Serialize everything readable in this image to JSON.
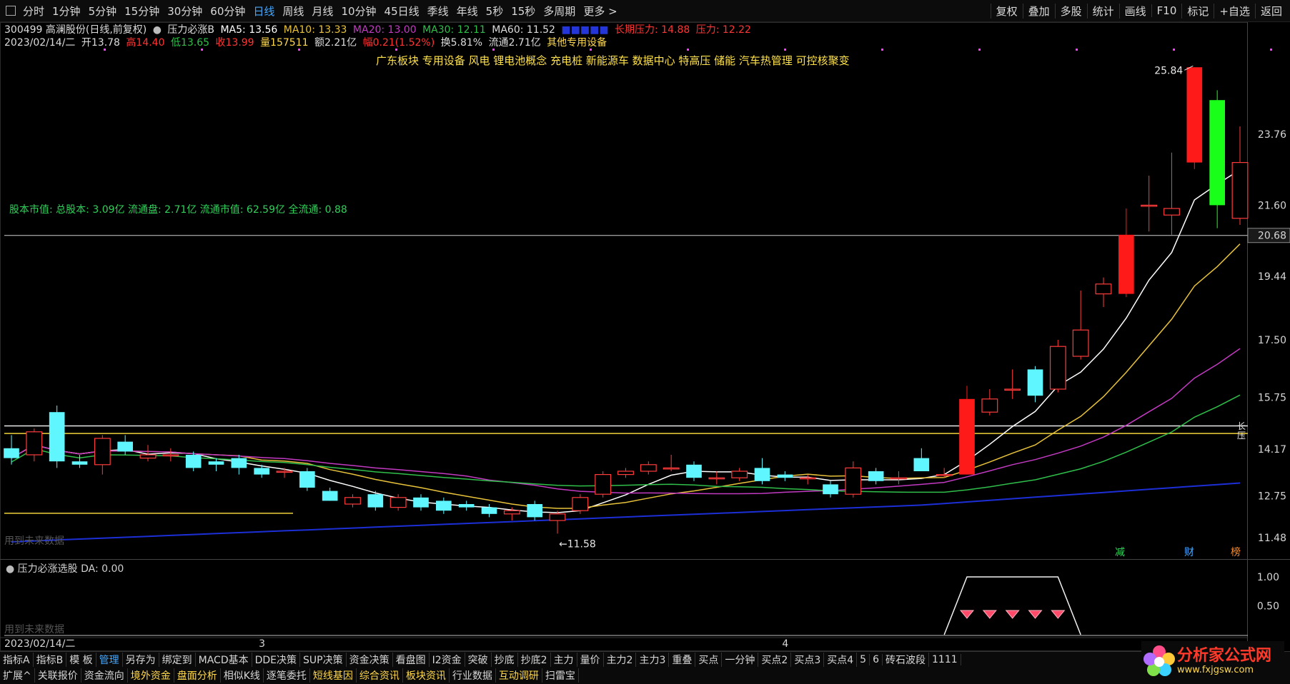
{
  "toolbar": {
    "periods": [
      "分时",
      "1分钟",
      "5分钟",
      "15分钟",
      "30分钟",
      "60分钟",
      "日线",
      "周线",
      "月线",
      "10分钟",
      "45日线",
      "季线",
      "年线",
      "5秒",
      "15秒",
      "多周期",
      "更多 >"
    ],
    "active_period": "日线",
    "right_buttons": [
      "复权",
      "叠加",
      "多股",
      "统计",
      "画线",
      "F10",
      "标记",
      "+自选",
      "返回"
    ]
  },
  "info": {
    "stock": "300499 高澜股份(日线,前复权)",
    "indicator": "压力必涨B",
    "ma5": "MA5: 13.56",
    "ma10": "MA10: 13.33",
    "ma20": "MA20: 13.00",
    "ma30": "MA30: 12.11",
    "ma60": "MA60: 11.52",
    "long_pressure": "长期压力: 14.88",
    "pressure": "压力: 12.22",
    "date": "2023/02/14/二",
    "open": "开13.78",
    "high": "高14.40",
    "low": "低13.65",
    "close": "收13.99",
    "volume": "量157511",
    "amount": "额2.21亿",
    "change": "幅0.21(1.52%)",
    "turnover": "换5.81%",
    "float": "流通2.71亿",
    "industry": "其他专用设备"
  },
  "tagline": "广东板块 专用设备 风电 锂电池概念 充电桩 新能源车 数据中心 特高压 储能 汽车热管理 可控核聚变",
  "share_text": "股本市值: 总股本: 3.09亿 流通盘: 2.71亿 流通市值: 62.59亿 全流通: 0.88",
  "watermark": "用到未来数据",
  "chart_data": {
    "type": "candlestick",
    "y_axis_labels": [
      "23.76",
      "21.60",
      "20.68",
      "19.44",
      "17.50",
      "15.75",
      "14.17",
      "12.75",
      "11.48"
    ],
    "ylim": [
      11.0,
      26.5
    ],
    "highlight_price": "20.68",
    "max_label": "25.84",
    "min_label": "11.58",
    "candles": [
      {
        "o": 14.2,
        "c": 13.9,
        "h": 14.6,
        "l": 13.7
      },
      {
        "o": 14.0,
        "c": 14.7,
        "h": 14.8,
        "l": 13.8
      },
      {
        "o": 15.3,
        "c": 13.8,
        "h": 15.5,
        "l": 13.6
      },
      {
        "o": 13.8,
        "c": 13.7,
        "h": 14.0,
        "l": 13.6
      },
      {
        "o": 13.7,
        "c": 14.5,
        "h": 14.6,
        "l": 13.4
      },
      {
        "o": 14.4,
        "c": 14.1,
        "h": 14.6,
        "l": 14.0
      },
      {
        "o": 13.9,
        "c": 14.0,
        "h": 14.3,
        "l": 13.8
      },
      {
        "o": 14.0,
        "c": 14.0,
        "h": 14.2,
        "l": 13.8
      },
      {
        "o": 14.0,
        "c": 13.6,
        "h": 14.1,
        "l": 13.5
      },
      {
        "o": 13.8,
        "c": 13.7,
        "h": 13.9,
        "l": 13.5
      },
      {
        "o": 13.9,
        "c": 13.6,
        "h": 14.0,
        "l": 13.4
      },
      {
        "o": 13.6,
        "c": 13.4,
        "h": 13.7,
        "l": 13.3
      },
      {
        "o": 13.5,
        "c": 13.5,
        "h": 13.6,
        "l": 13.3
      },
      {
        "o": 13.5,
        "c": 13.0,
        "h": 13.6,
        "l": 12.9
      },
      {
        "o": 12.9,
        "c": 12.6,
        "h": 13.0,
        "l": 12.6
      },
      {
        "o": 12.5,
        "c": 12.7,
        "h": 12.8,
        "l": 12.4
      },
      {
        "o": 12.8,
        "c": 12.4,
        "h": 12.9,
        "l": 12.3
      },
      {
        "o": 12.4,
        "c": 12.7,
        "h": 12.8,
        "l": 12.3
      },
      {
        "o": 12.7,
        "c": 12.4,
        "h": 12.8,
        "l": 12.3
      },
      {
        "o": 12.6,
        "c": 12.3,
        "h": 12.7,
        "l": 12.2
      },
      {
        "o": 12.5,
        "c": 12.4,
        "h": 12.6,
        "l": 12.3
      },
      {
        "o": 12.4,
        "c": 12.2,
        "h": 12.5,
        "l": 12.1
      },
      {
        "o": 12.2,
        "c": 12.3,
        "h": 12.4,
        "l": 12.0
      },
      {
        "o": 12.5,
        "c": 12.1,
        "h": 12.6,
        "l": 12.0
      },
      {
        "o": 12.0,
        "c": 12.2,
        "h": 12.3,
        "l": 11.6
      },
      {
        "o": 12.3,
        "c": 12.7,
        "h": 12.8,
        "l": 12.2
      },
      {
        "o": 12.8,
        "c": 13.4,
        "h": 13.5,
        "l": 12.7
      },
      {
        "o": 13.4,
        "c": 13.5,
        "h": 13.6,
        "l": 13.3
      },
      {
        "o": 13.5,
        "c": 13.7,
        "h": 13.8,
        "l": 13.4
      },
      {
        "o": 13.6,
        "c": 13.6,
        "h": 14.0,
        "l": 13.5
      },
      {
        "o": 13.7,
        "c": 13.3,
        "h": 13.8,
        "l": 13.2
      },
      {
        "o": 13.3,
        "c": 13.3,
        "h": 13.5,
        "l": 13.1
      },
      {
        "o": 13.3,
        "c": 13.5,
        "h": 13.6,
        "l": 13.2
      },
      {
        "o": 13.6,
        "c": 13.2,
        "h": 13.9,
        "l": 13.1
      },
      {
        "o": 13.4,
        "c": 13.3,
        "h": 13.5,
        "l": 13.2
      },
      {
        "o": 13.3,
        "c": 13.3,
        "h": 13.4,
        "l": 13.1
      },
      {
        "o": 13.1,
        "c": 12.8,
        "h": 13.2,
        "l": 12.7
      },
      {
        "o": 12.8,
        "c": 13.6,
        "h": 13.8,
        "l": 12.7
      },
      {
        "o": 13.5,
        "c": 13.2,
        "h": 13.6,
        "l": 13.1
      },
      {
        "o": 13.3,
        "c": 13.3,
        "h": 13.5,
        "l": 13.1
      },
      {
        "o": 13.9,
        "c": 13.5,
        "h": 14.2,
        "l": 13.5
      },
      {
        "o": 13.4,
        "c": 13.4,
        "h": 13.6,
        "l": 13.3
      },
      {
        "o": 13.4,
        "c": 15.7,
        "h": 16.1,
        "l": 13.4
      },
      {
        "o": 15.3,
        "c": 15.7,
        "h": 16.0,
        "l": 15.2
      },
      {
        "o": 16.0,
        "c": 16.0,
        "h": 16.6,
        "l": 15.7
      },
      {
        "o": 16.6,
        "c": 15.8,
        "h": 16.7,
        "l": 15.6
      },
      {
        "o": 16.0,
        "c": 17.3,
        "h": 17.5,
        "l": 15.9
      },
      {
        "o": 17.0,
        "c": 17.8,
        "h": 19.0,
        "l": 16.9
      },
      {
        "o": 18.9,
        "c": 19.2,
        "h": 19.4,
        "l": 18.5
      },
      {
        "o": 18.9,
        "c": 20.7,
        "h": 21.5,
        "l": 18.8
      },
      {
        "o": 21.6,
        "c": 21.6,
        "h": 22.5,
        "l": 20.8
      },
      {
        "o": 21.3,
        "c": 21.5,
        "h": 23.2,
        "l": 20.7
      },
      {
        "o": 22.9,
        "c": 25.8,
        "h": 25.8,
        "l": 22.7
      },
      {
        "o": 24.8,
        "c": 21.6,
        "h": 25.1,
        "l": 20.9
      },
      {
        "o": 21.2,
        "c": 22.9,
        "h": 24.0,
        "l": 21.0
      }
    ],
    "ma_colors": {
      "ma5": "#ffffff",
      "ma10": "#e8c23a",
      "ma20": "#c23ac2",
      "ma30": "#2fbf4a",
      "ma60": "#1c2fd6"
    },
    "sub_chart": {
      "title": "压力必涨选股",
      "value": "DA: 0.00",
      "y_axis_labels": [
        "1.00",
        "0.50"
      ],
      "ylim": [
        0,
        1.0
      ],
      "signal_start": 42,
      "signal_end": 46
    },
    "x_axis": {
      "date": "2023/02/14/二",
      "month_labels": [
        {
          "index": 11,
          "label": "3"
        },
        {
          "index": 34,
          "label": "4"
        }
      ]
    },
    "markers": [
      "减",
      "财",
      "榜"
    ]
  },
  "bottom_bar1": [
    "指标A",
    "指标B",
    "模 板",
    "管理",
    "另存为",
    "绑定到",
    "MACD基本",
    "DDE决策",
    "SUP决策",
    "资金决策",
    "看盘图",
    "I2资金",
    "突破",
    "抄底",
    "抄底2",
    "主力",
    "量价",
    "主力2",
    "主力3",
    "重叠",
    "买点",
    "一分钟",
    "买点2",
    "买点3",
    "买点4",
    "5",
    "6",
    "砖石波段",
    "1111"
  ],
  "bottom_bar2": [
    "扩展^",
    "关联报价",
    "资金流向",
    "境外资金",
    "盘面分析",
    "相似K线",
    "逐笔委托",
    "短线基因",
    "综合资讯",
    "板块资讯",
    "行业数据",
    "互动调研",
    "扫雷宝"
  ],
  "logo": {
    "name": "分析家公式网",
    "url": "www.fxjgsw.com"
  }
}
